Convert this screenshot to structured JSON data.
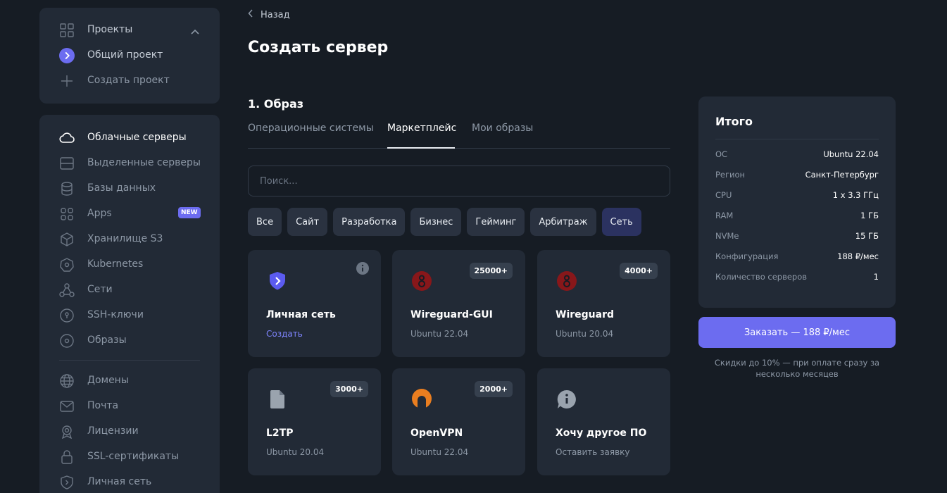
{
  "projects": {
    "header_label": "Проекты",
    "items": [
      {
        "label": "Общий проект"
      },
      {
        "label": "Создать проект"
      }
    ]
  },
  "sidebar": {
    "items": [
      {
        "label": "Облачные серверы",
        "icon": "cloud-icon"
      },
      {
        "label": "Выделенные серверы",
        "icon": "server-icon"
      },
      {
        "label": "Базы данных",
        "icon": "database-icon"
      },
      {
        "label": "Apps",
        "icon": "apps-icon",
        "badge": "NEW"
      },
      {
        "label": "Хранилище S3",
        "icon": "box-icon"
      },
      {
        "label": "Kubernetes",
        "icon": "kubernetes-icon"
      },
      {
        "label": "Сети",
        "icon": "network-icon"
      },
      {
        "label": "SSH-ключи",
        "icon": "key-icon"
      },
      {
        "label": "Образы",
        "icon": "disk-icon"
      },
      {
        "label": "Домены",
        "icon": "globe-icon"
      },
      {
        "label": "Почта",
        "icon": "mail-icon"
      },
      {
        "label": "Лицензии",
        "icon": "award-icon"
      },
      {
        "label": "SSL-сертификаты",
        "icon": "lock-icon"
      },
      {
        "label": "Личная сеть",
        "icon": "shield-icon"
      }
    ]
  },
  "main": {
    "back_label": "Назад",
    "title": "Создать сервер",
    "section_title": "1. Образ",
    "tabs": [
      {
        "label": "Операционные системы"
      },
      {
        "label": "Маркетплейс"
      },
      {
        "label": "Мои образы"
      }
    ],
    "search_placeholder": "Поиск...",
    "filters": [
      {
        "label": "Все"
      },
      {
        "label": "Сайт"
      },
      {
        "label": "Разработка"
      },
      {
        "label": "Бизнес"
      },
      {
        "label": "Гейминг"
      },
      {
        "label": "Арбитраж"
      },
      {
        "label": "Сеть"
      }
    ],
    "cards": [
      {
        "title": "Личная сеть",
        "subtitle": "Создать",
        "icon": "shield-icon"
      },
      {
        "title": "Wireguard-GUI",
        "subtitle": "Ubuntu 22.04",
        "badge": "25000+",
        "icon": "wireguard-icon"
      },
      {
        "title": "Wireguard",
        "subtitle": "Ubuntu 20.04",
        "badge": "4000+",
        "icon": "wireguard-icon"
      },
      {
        "title": "L2TP",
        "subtitle": "Ubuntu 20.04",
        "badge": "3000+",
        "icon": "file-icon"
      },
      {
        "title": "OpenVPN",
        "subtitle": "Ubuntu 22.04",
        "badge": "2000+",
        "icon": "openvpn-icon"
      },
      {
        "title": "Хочу другое ПО",
        "subtitle": "Оставить заявку",
        "icon": "chat-info-icon"
      }
    ]
  },
  "summary": {
    "title": "Итого",
    "rows": [
      {
        "key": "ОС",
        "value": "Ubuntu 22.04"
      },
      {
        "key": "Регион",
        "value": "Санкт-Петербург"
      },
      {
        "key": "CPU",
        "value": "1 x 3.3 ГГц"
      },
      {
        "key": "RAM",
        "value": "1 ГБ"
      },
      {
        "key": "NVMe",
        "value": "15 ГБ"
      },
      {
        "key": "Конфигурация",
        "value": "188 ₽/мес"
      },
      {
        "key": "Количество серверов",
        "value": "1"
      }
    ],
    "order_label": "Заказать — 188 ₽/мес",
    "discount_line1": "Скидки до 10% — при оплате сразу за",
    "discount_line2": "несколько месяцев"
  },
  "colors": {
    "background": "#161c24",
    "panel": "#222a36",
    "accent": "#6c6cf0",
    "link": "#7f85ff",
    "wireguard_red": "#88171a",
    "openvpn_orange": "#ea7e20"
  }
}
